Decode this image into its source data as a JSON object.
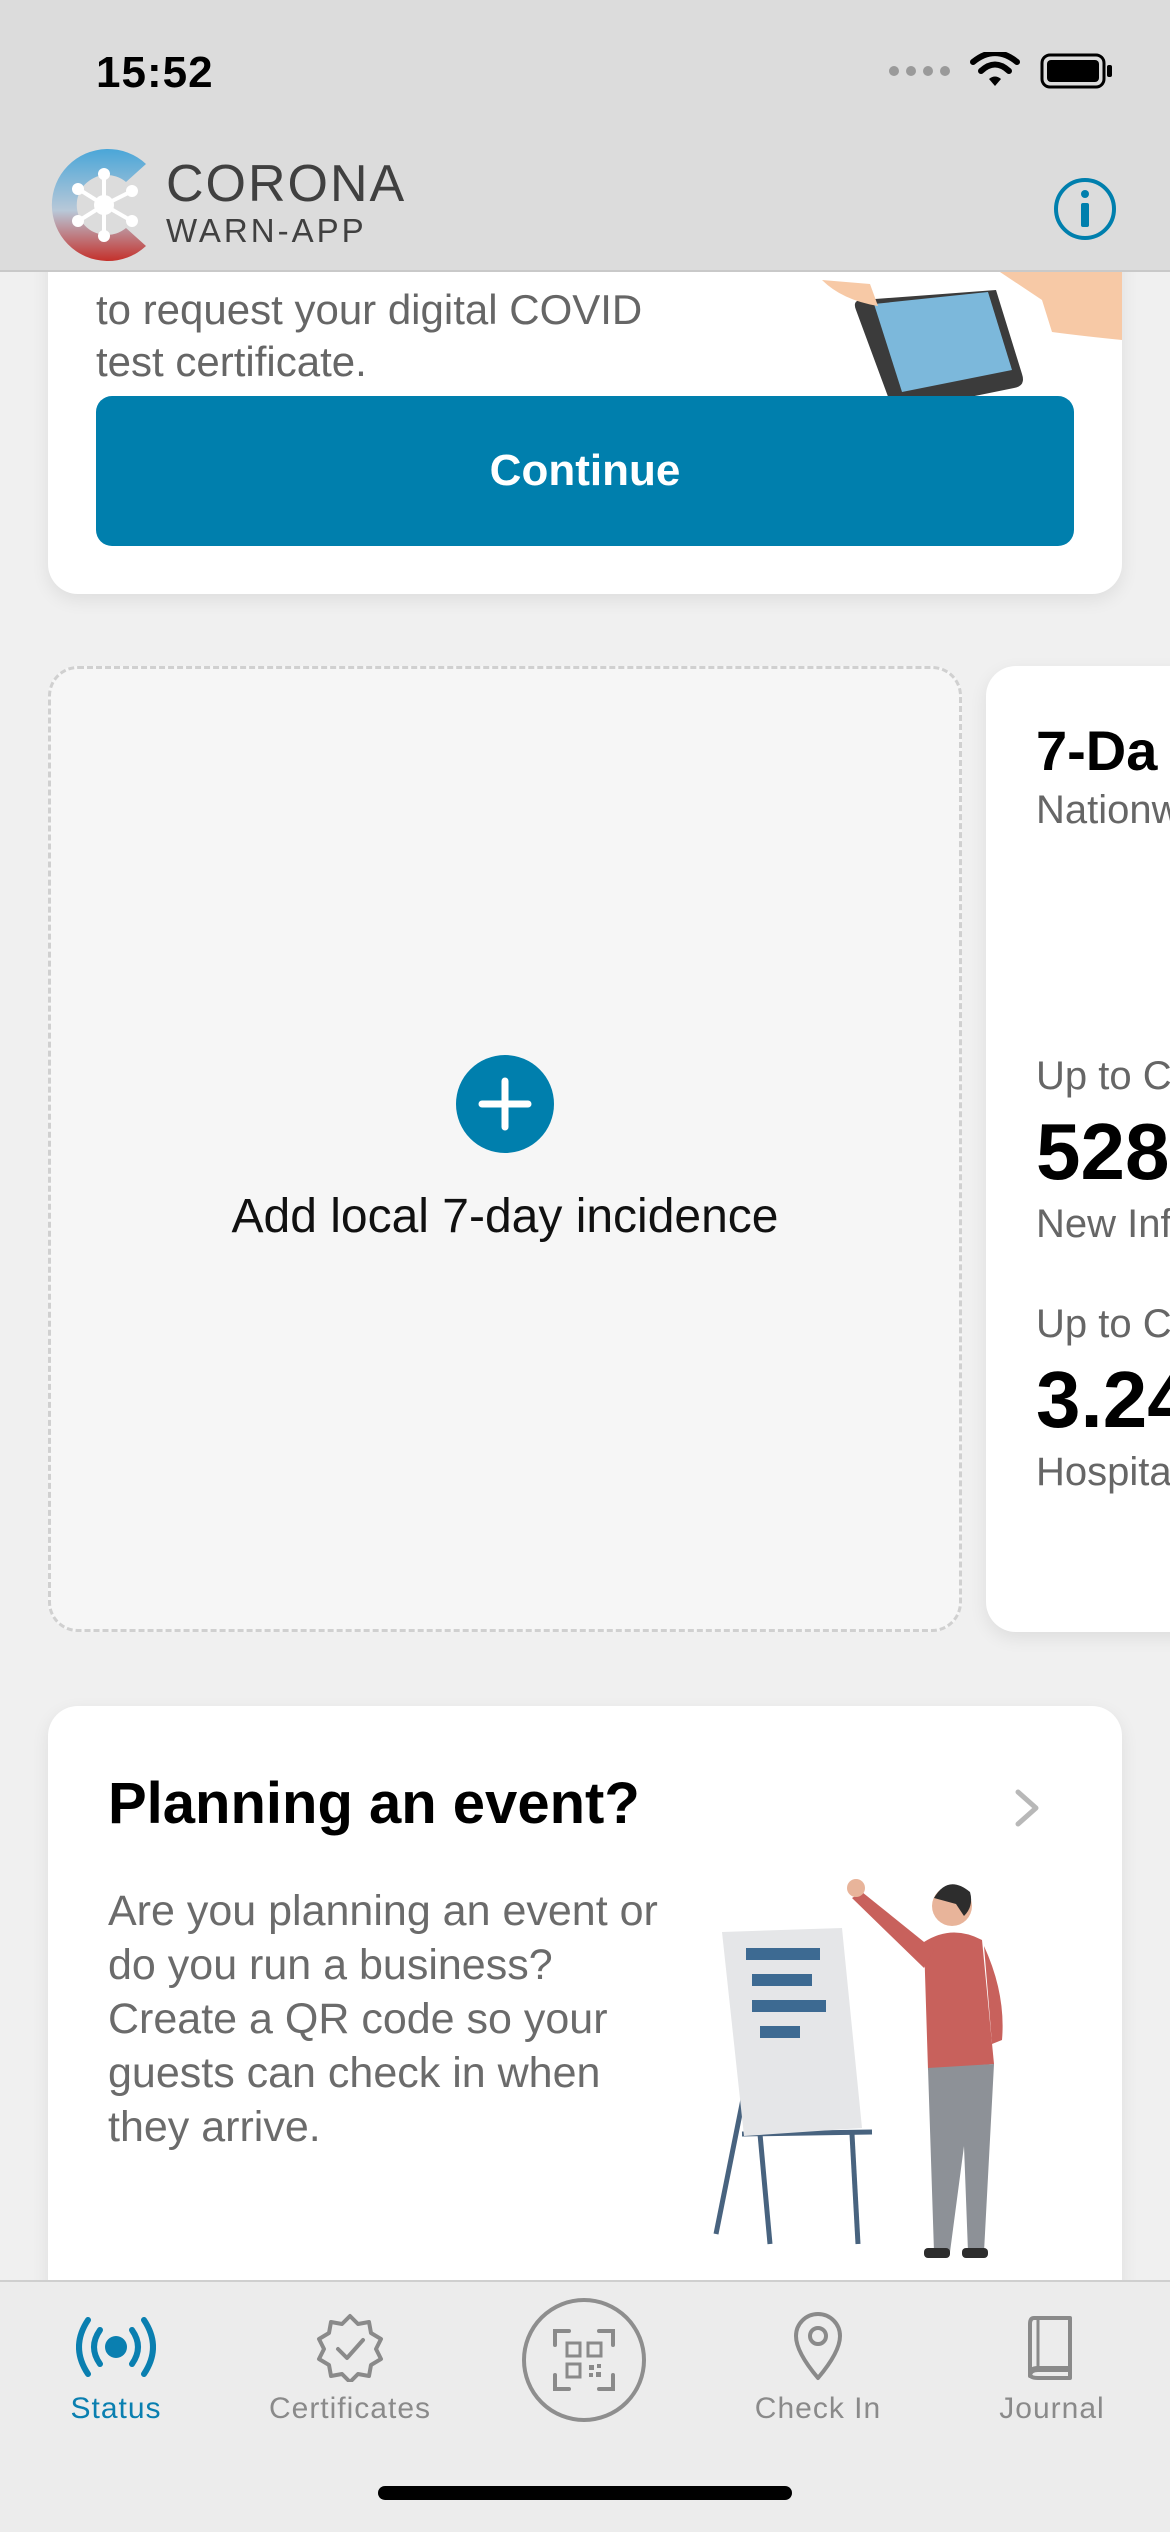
{
  "status_bar": {
    "time": "15:52"
  },
  "header": {
    "brand_line1": "CORONA",
    "brand_line2": "WARN-APP",
    "info_icon": "info-circle-icon",
    "accent_color": "#007fad"
  },
  "test_card": {
    "text_partial": "to request your digital COVID",
    "text_line2": "test certificate.",
    "continue_label": "Continue"
  },
  "incidence": {
    "add_label": "Add local 7-day incidence",
    "add_icon": "plus-circle-icon"
  },
  "statistics": {
    "title": "7-Da",
    "subtitle": "Nationw",
    "infections_caption": "Up to C",
    "infections_value": "528",
    "infections_label": "New Inf",
    "hosp_caption": "Up to C",
    "hosp_value": "3.24",
    "hosp_label": "Hospita"
  },
  "event_card": {
    "title": "Planning an event?",
    "body": "Are you planning an event or do you run a business? Create a QR code so your guests can check in when they arrive."
  },
  "tabbar": {
    "status": "Status",
    "certificates": "Certificates",
    "checkin": "Check In",
    "journal": "Journal",
    "active_color": "#0a7fb0"
  }
}
